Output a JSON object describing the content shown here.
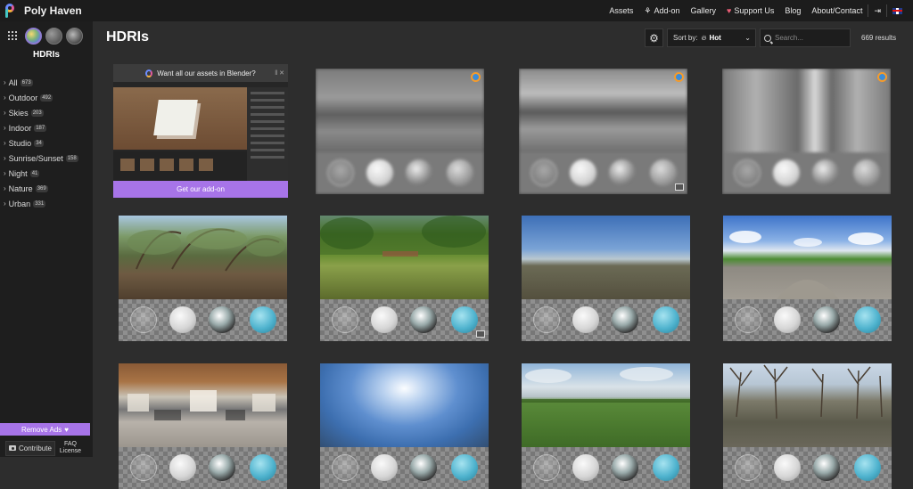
{
  "brand": {
    "name": "Poly Haven"
  },
  "topnav": {
    "assets": "Assets",
    "addon": "Add-on",
    "gallery": "Gallery",
    "support": "Support Us",
    "blog": "Blog",
    "about": "About/Contact"
  },
  "sidebar": {
    "title": "HDRIs",
    "categories": [
      {
        "label": "All",
        "count": "673"
      },
      {
        "label": "Outdoor",
        "count": "492"
      },
      {
        "label": "Skies",
        "count": "203"
      },
      {
        "label": "Indoor",
        "count": "187"
      },
      {
        "label": "Studio",
        "count": "34"
      },
      {
        "label": "Sunrise/Sunset",
        "count": "158"
      },
      {
        "label": "Night",
        "count": "41"
      },
      {
        "label": "Nature",
        "count": "369"
      },
      {
        "label": "Urban",
        "count": "331"
      }
    ],
    "remove_ads": "Remove Ads",
    "contribute": "Contribute",
    "faq_line1": "FAQ",
    "faq_line2": "License"
  },
  "main": {
    "title": "HDRIs",
    "sort_label": "Sort by:",
    "sort_value": "Hot",
    "search_placeholder": "Search...",
    "results": "669 results"
  },
  "ad": {
    "headline": "Want all our assets in Blender?",
    "cta": "Get our add-on"
  },
  "colors": {
    "accent_purple": "#a774e8",
    "background": "#2d2d2d",
    "sidebar": "#1e1e1e",
    "topbar": "#1c1c1c"
  }
}
